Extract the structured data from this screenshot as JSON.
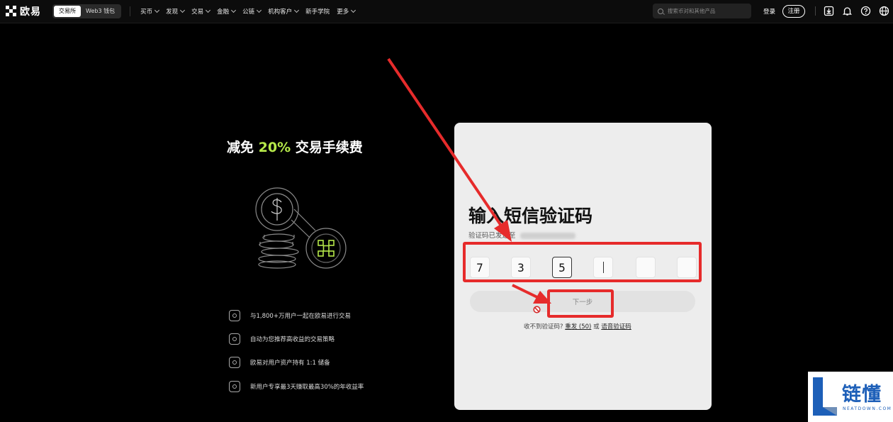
{
  "topbar": {
    "logo_text": "欧易",
    "segments": [
      "交易所",
      "Web3 钱包"
    ],
    "nav": [
      {
        "label": "买币",
        "has_dropdown": true
      },
      {
        "label": "发现",
        "has_dropdown": true
      },
      {
        "label": "交易",
        "has_dropdown": true
      },
      {
        "label": "金融",
        "has_dropdown": true
      },
      {
        "label": "公链",
        "has_dropdown": true
      },
      {
        "label": "机构客户",
        "has_dropdown": true
      },
      {
        "label": "新手学院",
        "has_dropdown": false
      },
      {
        "label": "更多",
        "has_dropdown": true
      }
    ],
    "search_placeholder": "搜索币对和其他产品",
    "login": "登录",
    "signup": "注册",
    "icons": [
      "download-icon",
      "bell-icon",
      "help-icon",
      "globe-icon"
    ]
  },
  "promo": {
    "title_prefix": "减免 ",
    "title_highlight": "20%",
    "title_suffix": " 交易手续费",
    "highlight_color": "#b6e94a",
    "features": [
      "与1,800+万用户一起在欧易进行交易",
      "自动为您推荐高收益的交易策略",
      "欧易对用户资产持有 1:1 储备",
      "新用户专享最3天赚取最高30%的年收益率"
    ]
  },
  "card": {
    "title": "输入短信验证码",
    "subtitle": "验证码已发送至",
    "code_digits": [
      "7",
      "3",
      "5",
      "",
      "",
      ""
    ],
    "next_button": "下一步",
    "help_text": "收不到验证码?",
    "resend": "重发 (50)",
    "or": "或",
    "voice": "语音验证码"
  },
  "watermark": {
    "text": "链懂",
    "sub": "NEATDOWN.COM"
  },
  "annotation_color": "#e62b2b"
}
